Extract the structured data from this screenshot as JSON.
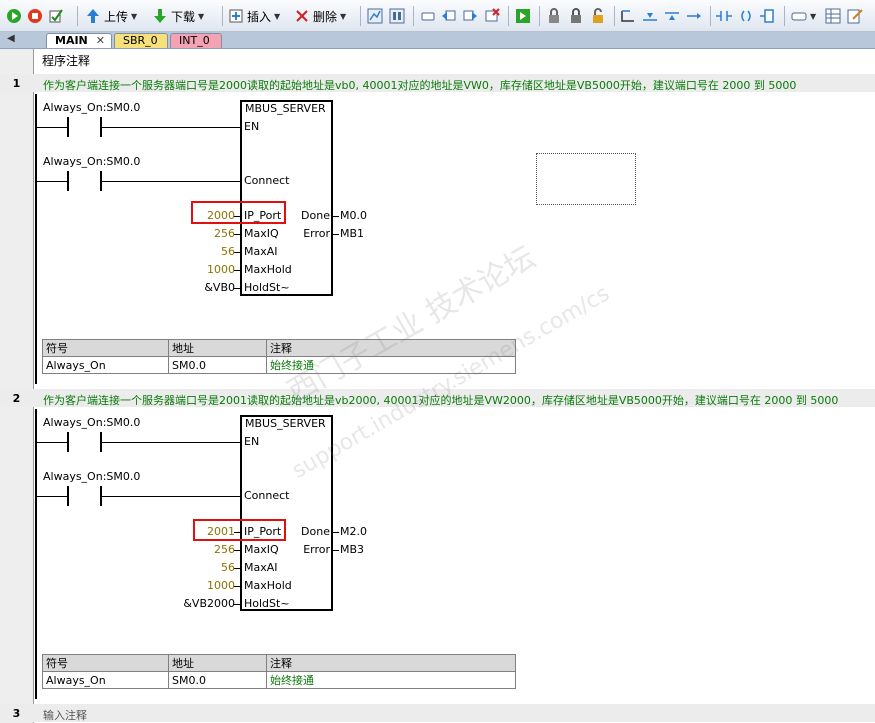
{
  "toolbar": {
    "upload_label": "上传",
    "download_label": "下载",
    "insert_label": "插入",
    "delete_label": "删除"
  },
  "tabs": [
    {
      "label": "MAIN"
    },
    {
      "label": "SBR_0"
    },
    {
      "label": "INT_0"
    }
  ],
  "program_comment": "程序注释",
  "networks": [
    {
      "number": "1",
      "comment": "作为客户端连接一个服务器端口号是2000读取的起始地址是vb0, 40001对应的地址是VW0，库存储区地址是VB5000开始，建议端口号在 2000 到 5000",
      "contact_1": "Always_On:SM0.0",
      "contact_2": "Always_On:SM0.0",
      "block_name": "MBUS_SERVER",
      "pins": {
        "en": "EN",
        "connect": "Connect",
        "ip_port": "IP_Port",
        "maxiq": "MaxIQ",
        "maxai": "MaxAI",
        "maxhold": "MaxHold",
        "holdst": "HoldSt~",
        "done": "Done",
        "error": "Error"
      },
      "inputs": {
        "ip_port": "2000",
        "maxiq": "256",
        "maxai": "56",
        "maxhold": "1000",
        "holdst": "&VB0"
      },
      "outputs": {
        "done": "M0.0",
        "error": "MB1"
      },
      "symbol_table": {
        "headers": [
          "符号",
          "地址",
          "注释"
        ],
        "rows": [
          [
            "Always_On",
            "SM0.0",
            "始终接通"
          ]
        ]
      }
    },
    {
      "number": "2",
      "comment": "作为客户端连接一个服务器端口号是2001读取的起始地址是vb2000, 40001对应的地址是VW2000，库存储区地址是VB5000开始，建议端口号在 2000 到 5000",
      "contact_1": "Always_On:SM0.0",
      "contact_2": "Always_On:SM0.0",
      "block_name": "MBUS_SERVER",
      "pins": {
        "en": "EN",
        "connect": "Connect",
        "ip_port": "IP_Port",
        "maxiq": "MaxIQ",
        "maxai": "MaxAI",
        "maxhold": "MaxHold",
        "holdst": "HoldSt~",
        "done": "Done",
        "error": "Error"
      },
      "inputs": {
        "ip_port": "2001",
        "maxiq": "256",
        "maxai": "56",
        "maxhold": "1000",
        "holdst": "&VB2000"
      },
      "outputs": {
        "done": "M2.0",
        "error": "MB3"
      },
      "symbol_table": {
        "headers": [
          "符号",
          "地址",
          "注释"
        ],
        "rows": [
          [
            "Always_On",
            "SM0.0",
            "始终接通"
          ]
        ]
      }
    },
    {
      "number": "3",
      "comment": "输入注释"
    }
  ],
  "watermark": {
    "line1": "西门子工业 技术论坛",
    "line2": "support.industry.siemens.com/cs"
  }
}
